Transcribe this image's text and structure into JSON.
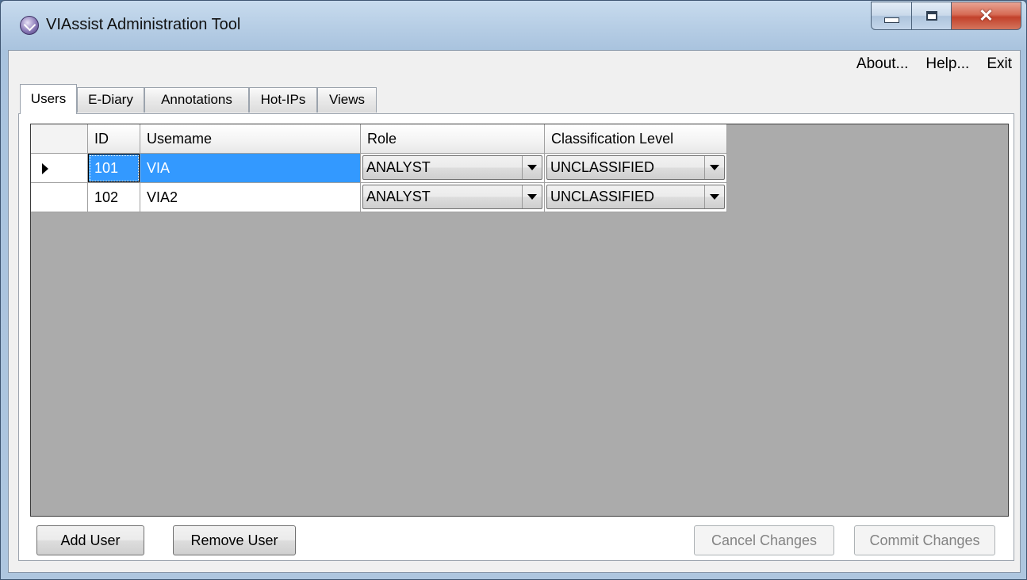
{
  "window": {
    "title": "VIAssist Administration Tool"
  },
  "menu": {
    "about": "About...",
    "help": "Help...",
    "exit": "Exit"
  },
  "tabs": [
    {
      "label": "Users",
      "active": true
    },
    {
      "label": "E-Diary",
      "active": false
    },
    {
      "label": "Annotations",
      "active": false
    },
    {
      "label": "Hot-IPs",
      "active": false
    },
    {
      "label": "Views",
      "active": false
    }
  ],
  "grid": {
    "columns": {
      "id": "ID",
      "username": "Usemame",
      "role": "Role",
      "classification": "Classification Level"
    },
    "rows": [
      {
        "id": "101",
        "username": "VIA",
        "role": "ANALYST",
        "classification": "UNCLASSIFIED",
        "selected": true
      },
      {
        "id": "102",
        "username": "VIA2",
        "role": "ANALYST",
        "classification": "UNCLASSIFIED",
        "selected": false
      }
    ]
  },
  "buttons": {
    "add_user": "Add User",
    "remove_user": "Remove User",
    "cancel_changes": "Cancel Changes",
    "commit_changes": "Commit Changes"
  },
  "colors": {
    "selection": "#3399ff",
    "grid_background": "#ababab"
  }
}
